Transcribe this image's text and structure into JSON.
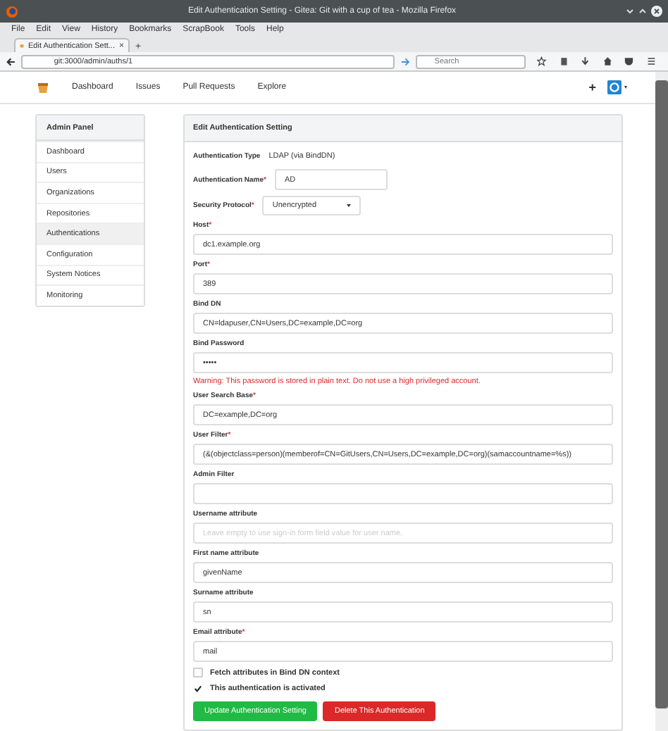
{
  "window": {
    "title": "Edit Authentication Setting - Gitea: Git with a cup of tea - Mozilla Firefox"
  },
  "menu": [
    "File",
    "Edit",
    "View",
    "History",
    "Bookmarks",
    "ScrapBook",
    "Tools",
    "Help"
  ],
  "browser_tab": {
    "title": "Edit Authentication Sett...",
    "close": "×",
    "new_tab": "+"
  },
  "url": "git:3000/admin/auths/1",
  "search": {
    "placeholder": "Search"
  },
  "nav": [
    "Dashboard",
    "Issues",
    "Pull Requests",
    "Explore"
  ],
  "nav_plus": "+",
  "sidebar": {
    "title": "Admin Panel",
    "items": [
      {
        "label": "Dashboard",
        "selected": false
      },
      {
        "label": "Users",
        "selected": false
      },
      {
        "label": "Organizations",
        "selected": false
      },
      {
        "label": "Repositories",
        "selected": false
      },
      {
        "label": "Authentications",
        "selected": true
      },
      {
        "label": "Configuration",
        "selected": false
      },
      {
        "label": "System Notices",
        "selected": false
      },
      {
        "label": "Monitoring",
        "selected": false
      }
    ]
  },
  "form": {
    "title": "Edit Authentication Setting",
    "type": {
      "label": "Authentication Type",
      "value": "LDAP (via BindDN)"
    },
    "fields": [
      {
        "kind": "inline",
        "label": "Authentication Name",
        "mark": "*",
        "value": "AD"
      },
      {
        "kind": "select",
        "label": "Security Protocol",
        "mark": "*",
        "value": "Unencrypted"
      },
      {
        "kind": "text",
        "label": "Host",
        "mark": "*",
        "value": "dc1.example.org"
      },
      {
        "kind": "text",
        "label": "Port",
        "mark": "*",
        "value": "389"
      },
      {
        "kind": "text",
        "label": "Bind DN",
        "value": "CN=ldapuser,CN=Users,DC=example,DC=org"
      },
      {
        "kind": "password",
        "label": "Bind Password",
        "value": "•••••",
        "warning": "Warning: This password is stored in plain text. Do not use a high privileged account."
      },
      {
        "kind": "text",
        "label": "User Search Base",
        "mark": "*",
        "value": "DC=example,DC=org"
      },
      {
        "kind": "text",
        "label": "User Filter",
        "mark": "*",
        "value": "(&(objectclass=person)(memberof=CN=GitUsers,CN=Users,DC=example,DC=org)(samaccountname=%s))"
      },
      {
        "kind": "text",
        "label": "Admin Filter"
      },
      {
        "kind": "text",
        "label": "Username attribute",
        "placeholder": "Leave empty to use sign-in form field value for user name."
      },
      {
        "kind": "text",
        "label": "First name attribute",
        "value": "givenName"
      },
      {
        "kind": "text",
        "label": "Surname attribute",
        "value": "sn"
      },
      {
        "kind": "text",
        "label": "Email attribute",
        "mark": "*",
        "value": "mail"
      }
    ],
    "checkboxes": [
      {
        "label": "Fetch attributes in Bind DN context",
        "checked": false
      },
      {
        "label": "This authentication is activated",
        "checked": true
      }
    ],
    "buttons": [
      {
        "label": "Update Authentication Setting",
        "kind": "primary"
      },
      {
        "label": "Delete This Authentication",
        "kind": "danger"
      }
    ]
  }
}
